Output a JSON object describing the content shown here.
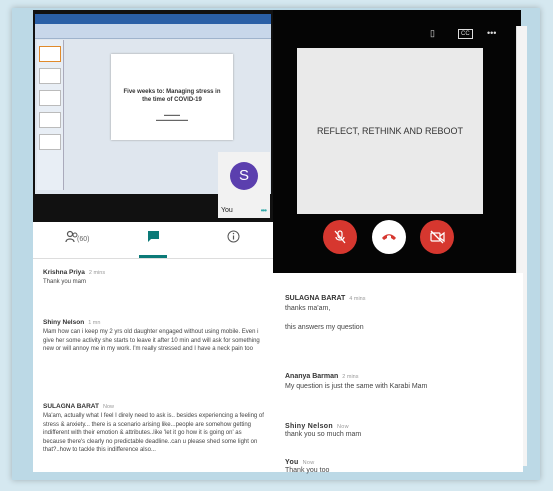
{
  "presentation": {
    "slide_title": "Five weeks to: Managing stress in the time of COVID-19"
  },
  "self_tile": {
    "avatar_letter": "S",
    "name": "You"
  },
  "tabs": {
    "people_count": "(60)"
  },
  "left_chat": [
    {
      "sender": "Krishna Priya",
      "time": "2 mins",
      "text": "Thank you mam"
    },
    {
      "sender": "Shiny Nelson",
      "time": "1 mn",
      "text": "Mam how can i keep my 2 yrs old daughter engaged without using mobile. Even i give her some activity she starts to leave it after 10 min and will ask for something new or will annoy me in my work. I'm really stressed and I have a neck pain too"
    },
    {
      "sender": "SULAGNA BARAT",
      "time": "Now",
      "text": "Ma'am, actually what I feel I direly need to ask is.. besides experiencing a feeling of stress & anxiety... there is a scenario arising like...people are somehow getting indifferent with their emotion & attributes..like 'let it go how it is going on' as because there's clearly no predictable deadline..can u please shed some light on that?..how to tackle this indifference also..."
    }
  ],
  "presentation_view": {
    "text": "REFLECT, RETHINK AND REBOOT"
  },
  "right_chat": [
    {
      "sender": "SULAGNA BARAT",
      "time": "4 mins",
      "lines": [
        "thanks ma'am,",
        "this answers my question"
      ]
    },
    {
      "sender": "Ananya Barman",
      "time": "2 mins",
      "lines": [
        "My question is just the same with Karabi Mam"
      ]
    },
    {
      "sender": "Shiny Nelson",
      "time": "Now",
      "lines": [
        "thank you so much mam"
      ]
    },
    {
      "sender": "You",
      "time": "Now",
      "lines": [
        "Thank you too"
      ]
    }
  ],
  "colors": {
    "accent": "#0b7a78",
    "end_call": "#d6372f",
    "avatar": "#5b3fae"
  }
}
